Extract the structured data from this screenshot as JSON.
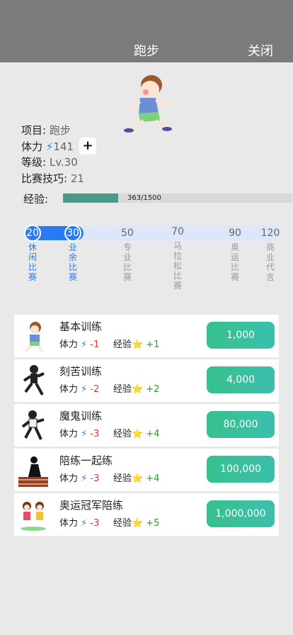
{
  "header": {
    "title": "跑步",
    "close_label": "关闭"
  },
  "info": {
    "project_label": "项目:",
    "project_value": "跑步",
    "stamina_label": "体力",
    "stamina_icon": "lightning-icon",
    "stamina_value": "141",
    "plus_label": "+",
    "level_label": "等级:",
    "level_value": "Lv.30",
    "skill_label": "比赛技巧:",
    "skill_value": "21"
  },
  "exp": {
    "label": "经验:",
    "text": "363/1500",
    "fraction": 0.242
  },
  "levels": [
    {
      "value": "20",
      "label": "休闲比赛",
      "active": true
    },
    {
      "value": "30",
      "label": "业余比赛",
      "active": true
    },
    {
      "value": "50",
      "label": "专业比赛",
      "active": false
    },
    {
      "value": "70",
      "label": "马拉松比赛",
      "active": false
    },
    {
      "value": "90",
      "label": "奥运比赛",
      "active": false
    },
    {
      "value": "120",
      "label": "商业代言",
      "active": false
    }
  ],
  "trainings": [
    {
      "name": "基本训练",
      "stamina_label": "体力",
      "stamina_cost": "-1",
      "exp_label": "经验",
      "exp_gain": "+1",
      "price": "1,000"
    },
    {
      "name": "刻苦训练",
      "stamina_label": "体力",
      "stamina_cost": "-2",
      "exp_label": "经验",
      "exp_gain": "+2",
      "price": "4,000"
    },
    {
      "name": "魔鬼训练",
      "stamina_label": "体力",
      "stamina_cost": "-3",
      "exp_label": "经验",
      "exp_gain": "+4",
      "price": "80,000"
    },
    {
      "name": "陪练一起练",
      "stamina_label": "体力",
      "stamina_cost": "-3",
      "exp_label": "经验",
      "exp_gain": "+4",
      "price": "100,000"
    },
    {
      "name": "奥运冠军陪练",
      "stamina_label": "体力",
      "stamina_cost": "-3",
      "exp_label": "经验",
      "exp_gain": "+5",
      "price": "1,000,000"
    }
  ],
  "colors": {
    "accent": "#2a7bf3",
    "button": "#38c18d",
    "exp_fill": "#4a9a8c",
    "header": "#7b7b7b"
  }
}
